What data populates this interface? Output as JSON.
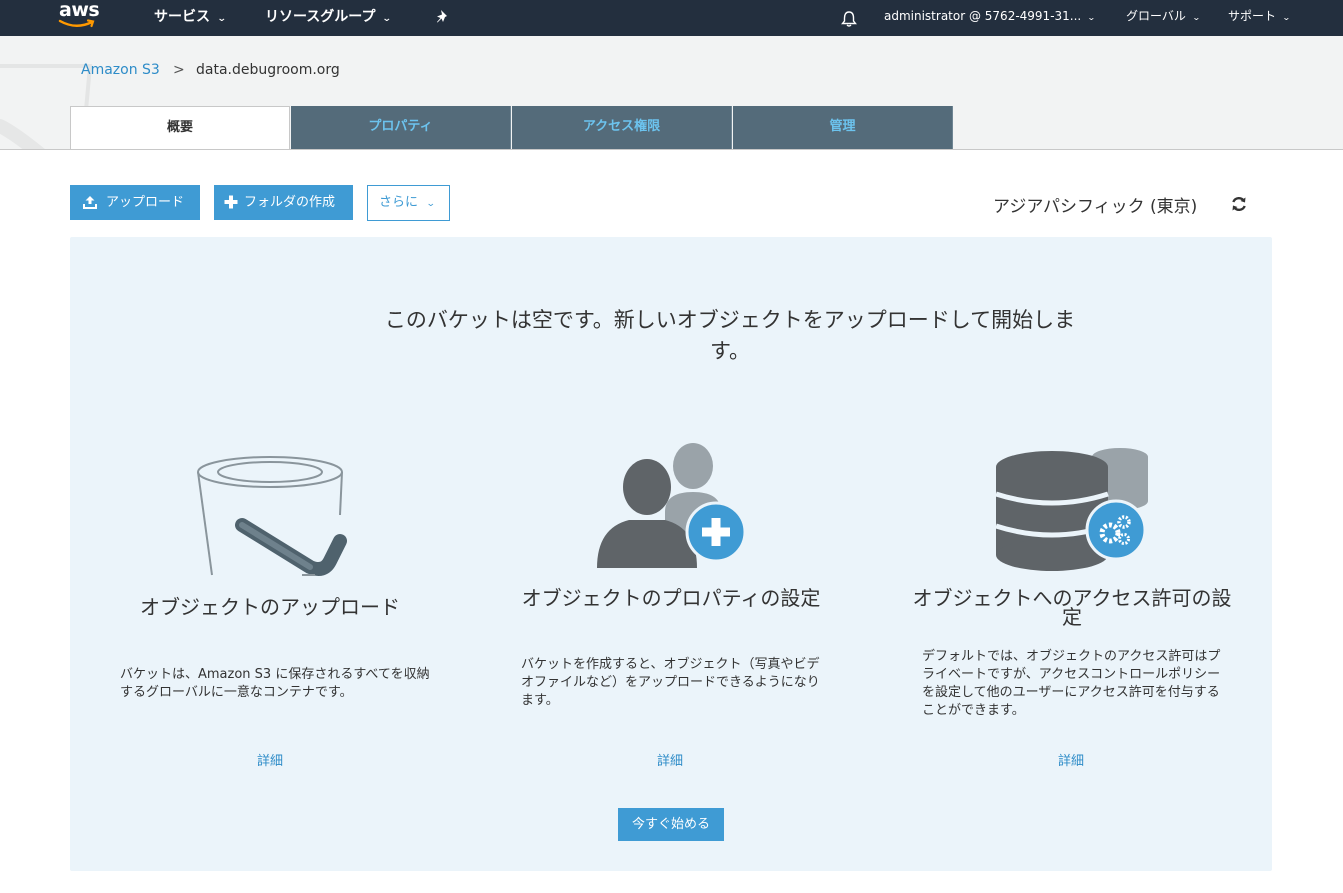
{
  "nav": {
    "logo_text": "aws",
    "services": "サービス",
    "resource_groups": "リソースグループ",
    "pin_icon": "pin-icon",
    "bell_icon": "bell-icon",
    "account": "administrator @ 5762-4991-31...",
    "region": "グローバル",
    "support": "サポート",
    "background_color": "#232f3e"
  },
  "breadcrumb": {
    "root": "Amazon S3",
    "separator": ">",
    "current": "data.debugroom.org"
  },
  "tabs": [
    {
      "label": "概要",
      "active": true
    },
    {
      "label": "プロパティ",
      "active": false
    },
    {
      "label": "アクセス権限",
      "active": false
    },
    {
      "label": "管理",
      "active": false
    }
  ],
  "toolbar": {
    "upload": "アップロード",
    "create_folder": "フォルダの作成",
    "more": "さらに",
    "region_label": "アジアパシフィック (東京)",
    "accent_color": "#3f9bd4"
  },
  "empty_state": {
    "title": "このバケットは空です。新しいオブジェクトをアップロードして開始します。",
    "cards": [
      {
        "icon": "bucket-icon",
        "title": "オブジェクトのアップロード",
        "desc": "バケットは、Amazon S3 に保存されるすべてを収納するグローバルに一意なコンテナです。",
        "link": "詳細"
      },
      {
        "icon": "users-add-icon",
        "title": "オブジェクトのプロパティの設定",
        "desc": "バケットを作成すると、オブジェクト（写真やビデオファイルなど）をアップロードできるようになります。",
        "link": "詳細"
      },
      {
        "icon": "database-settings-icon",
        "title": "オブジェクトへのアクセス許可の設定",
        "desc": "デフォルトでは、オブジェクトのアクセス許可はプライベートですが、アクセスコントロールポリシーを設定して他のユーザーにアクセス許可を付与することができます。",
        "link": "詳細"
      }
    ],
    "start_button": "今すぐ始める"
  }
}
